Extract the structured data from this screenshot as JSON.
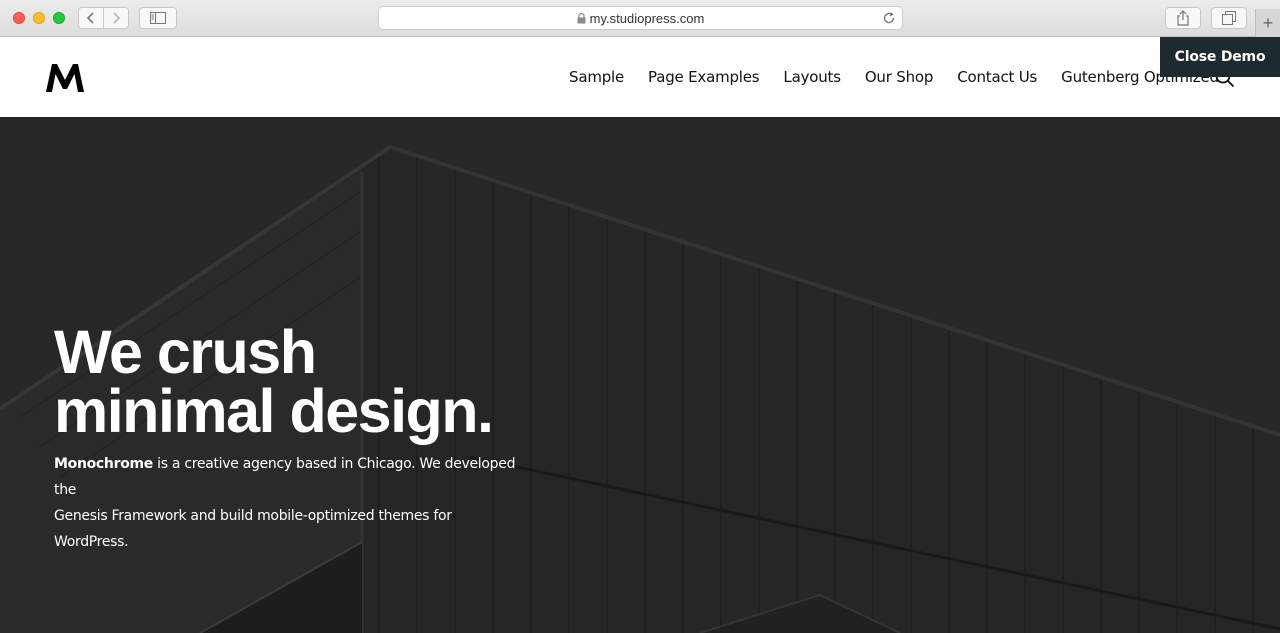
{
  "browser": {
    "url": "my.studiopress.com",
    "new_tab_label": "+"
  },
  "site": {
    "logo_text": "M",
    "nav": [
      "Sample",
      "Page Examples",
      "Layouts",
      "Our Shop",
      "Contact Us",
      "Gutenberg Optimized"
    ],
    "close_demo_label": "Close Demo"
  },
  "hero": {
    "title_line1": "We crush",
    "title_line2": "minimal design.",
    "desc_brand": "Monochrome",
    "desc_line1_rest": " is a creative agency based in Chicago. We developed the",
    "desc_line2": "Genesis Framework and build mobile-optimized themes for WordPress."
  },
  "colors": {
    "close_demo_bg": "#1f2a30",
    "hero_bg": "#2a2a2a"
  }
}
